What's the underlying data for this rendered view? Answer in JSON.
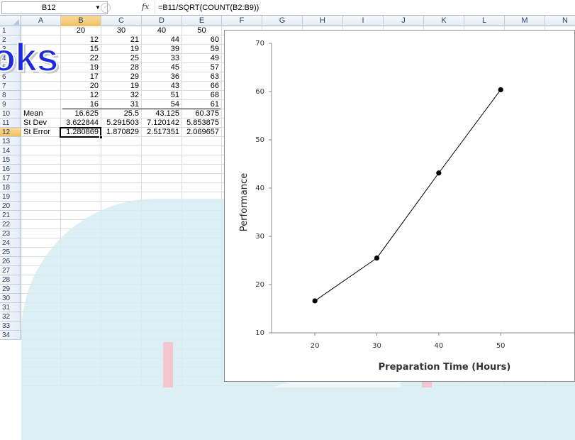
{
  "formula_bar": {
    "name_box": "B12",
    "fx_label": "fx",
    "formula": "=B11/SQRT(COUNT(B2:B9))"
  },
  "columns": [
    "A",
    "B",
    "C",
    "D",
    "E",
    "F",
    "G",
    "H",
    "I",
    "J",
    "K",
    "L",
    "M",
    "N"
  ],
  "selected_column": "B",
  "rows": [
    "1",
    "2",
    "3",
    "4",
    "5",
    "6",
    "7",
    "8",
    "9",
    "10",
    "11",
    "12",
    "13",
    "14",
    "15",
    "16",
    "17",
    "18",
    "19",
    "20",
    "21",
    "22",
    "23",
    "24",
    "25",
    "26",
    "27",
    "28",
    "29",
    "30",
    "31",
    "32",
    "33",
    "34"
  ],
  "selected_row": "12",
  "sheet": {
    "header_row": [
      "20",
      "30",
      "40",
      "50"
    ],
    "data": [
      [
        "12",
        "21",
        "44",
        "60"
      ],
      [
        "15",
        "19",
        "39",
        "59"
      ],
      [
        "22",
        "25",
        "33",
        "49"
      ],
      [
        "19",
        "28",
        "45",
        "57"
      ],
      [
        "17",
        "29",
        "36",
        "63"
      ],
      [
        "20",
        "19",
        "43",
        "66"
      ],
      [
        "12",
        "32",
        "51",
        "68"
      ],
      [
        "16",
        "31",
        "54",
        "61"
      ]
    ],
    "stats": [
      {
        "label": "Mean",
        "values": [
          "16.625",
          "25.5",
          "43.125",
          "60.375"
        ]
      },
      {
        "label": "St Dev",
        "values": [
          "3.622844",
          "5.291503",
          "7.120142",
          "5.853875"
        ]
      },
      {
        "label": "St Error",
        "values": [
          "1.280869",
          "1.870829",
          "2.517351",
          "2.069657"
        ]
      }
    ]
  },
  "watermark": {
    "text": "oks",
    "colors": {
      "text": "#1e2bd8",
      "arch": "#d6ecf3"
    }
  },
  "chart_data": {
    "type": "line",
    "x": [
      20,
      30,
      40,
      50
    ],
    "series": [
      {
        "values": [
          16.625,
          25.5,
          43.125,
          60.375
        ]
      }
    ],
    "xlabel": "Preparation Time (Hours)",
    "ylabel": "Performance",
    "xlim": [
      13,
      62
    ],
    "ylim": [
      10,
      70
    ],
    "xticks": [
      "20",
      "30",
      "40",
      "50"
    ],
    "yticks": [
      "10",
      "20",
      "30",
      "40",
      "50",
      "60",
      "70"
    ],
    "grid": false,
    "line_color": "#000000",
    "marker": "circle"
  }
}
